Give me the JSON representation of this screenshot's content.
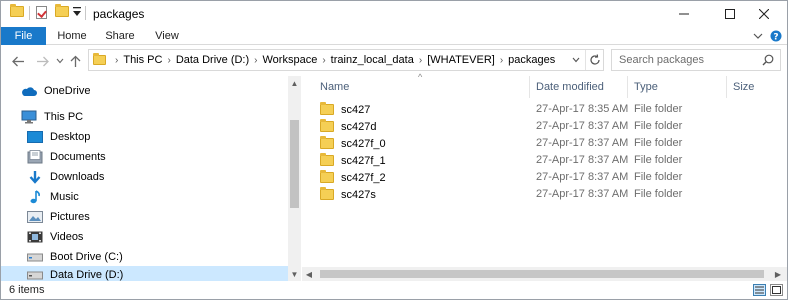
{
  "window": {
    "title": "packages",
    "controls": {
      "minimize": "minimize",
      "maximize": "maximize",
      "close": "close"
    }
  },
  "ribbon": {
    "tabs": [
      {
        "label": "File"
      },
      {
        "label": "Home"
      },
      {
        "label": "Share"
      },
      {
        "label": "View"
      }
    ]
  },
  "address": {
    "crumbs": [
      "This PC",
      "Data Drive (D:)",
      "Workspace",
      "trainz_local_data",
      "[WHATEVER]",
      "packages"
    ]
  },
  "search": {
    "placeholder": "Search packages"
  },
  "nav": {
    "items": [
      {
        "label": "OneDrive",
        "icon": "onedrive-icon"
      },
      {
        "label": "This PC",
        "icon": "computer-icon"
      },
      {
        "label": "Desktop",
        "icon": "desktop-icon"
      },
      {
        "label": "Documents",
        "icon": "documents-icon"
      },
      {
        "label": "Downloads",
        "icon": "downloads-icon"
      },
      {
        "label": "Music",
        "icon": "music-icon"
      },
      {
        "label": "Pictures",
        "icon": "pictures-icon"
      },
      {
        "label": "Videos",
        "icon": "videos-icon"
      },
      {
        "label": "Boot Drive (C:)",
        "icon": "drive-icon"
      },
      {
        "label": "Data Drive (D:)",
        "icon": "drive-icon"
      }
    ]
  },
  "columns": {
    "name": "Name",
    "date": "Date modified",
    "type": "Type",
    "size": "Size"
  },
  "files": [
    {
      "name": "sc427",
      "date": "27-Apr-17 8:35 AM",
      "type": "File folder"
    },
    {
      "name": "sc427d",
      "date": "27-Apr-17 8:37 AM",
      "type": "File folder"
    },
    {
      "name": "sc427f_0",
      "date": "27-Apr-17 8:37 AM",
      "type": "File folder"
    },
    {
      "name": "sc427f_1",
      "date": "27-Apr-17 8:37 AM",
      "type": "File folder"
    },
    {
      "name": "sc427f_2",
      "date": "27-Apr-17 8:37 AM",
      "type": "File folder"
    },
    {
      "name": "sc427s",
      "date": "27-Apr-17 8:37 AM",
      "type": "File folder"
    }
  ],
  "status": {
    "item_count": "6 items"
  },
  "colors": {
    "accent": "#1979ca",
    "selection": "#cce8ff",
    "folder": "#f5cf55"
  }
}
